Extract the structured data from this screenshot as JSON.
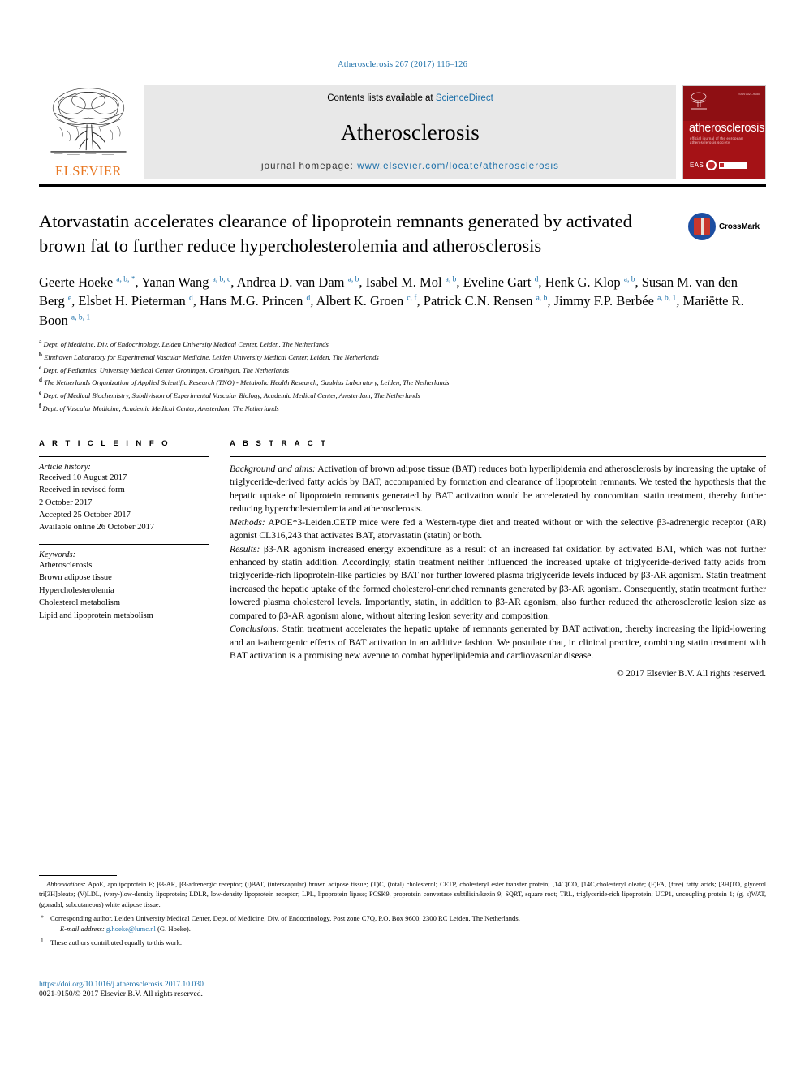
{
  "running_head": "Atherosclerosis 267 (2017) 116–126",
  "accent_color": "#1a6ea8",
  "banner": {
    "publisher_name": "ELSEVIER",
    "publisher_logo_icon": "elsevier-tree-icon",
    "contents_prefix": "Contents lists available at ",
    "contents_link": "ScienceDirect",
    "journal_title": "Atherosclerosis",
    "homepage_label": "journal homepage: ",
    "homepage_url": "www.elsevier.com/locate/atherosclerosis",
    "cover": {
      "journal_name": "atherosclerosis",
      "subtitle": "official journal of the european atherosclerosis society",
      "issn_text": "ISSN 0021-9150",
      "society_label": "EAS",
      "brand_color": "#a51216"
    }
  },
  "article": {
    "title": "Atorvastatin accelerates clearance of lipoprotein remnants generated by activated brown fat to further reduce hypercholesterolemia and atherosclerosis",
    "crossmark_label": "CrossMark",
    "authors_html": "Geerte Hoeke <sup>a, b, *</sup>, Yanan Wang <sup>a, b, c</sup>, Andrea D. van Dam <sup>a, b</sup>, Isabel M. Mol <sup>a, b</sup>, Eveline Gart <sup>d</sup>, Henk G. Klop <sup>a, b</sup>, Susan M. van den Berg <sup>e</sup>, Elsbet H. Pieterman <sup>d</sup>, Hans M.G. Princen <sup>d</sup>, Albert K. Groen <sup>c, f</sup>, Patrick C.N. Rensen <sup>a, b</sup>, Jimmy F.P. Berbée <sup>a, b, 1</sup>, Mariëtte R. Boon <sup>a, b, 1</sup>",
    "affiliations": [
      {
        "mark": "a",
        "text": "Dept. of Medicine, Div. of Endocrinology, Leiden University Medical Center, Leiden, The Netherlands"
      },
      {
        "mark": "b",
        "text": "Einthoven Laboratory for Experimental Vascular Medicine, Leiden University Medical Center, Leiden, The Netherlands"
      },
      {
        "mark": "c",
        "text": "Dept. of Pediatrics, University Medical Center Groningen, Groningen, The Netherlands"
      },
      {
        "mark": "d",
        "text": "The Netherlands Organization of Applied Scientific Research (TNO) - Metabolic Health Research, Gaubius Laboratory, Leiden, The Netherlands"
      },
      {
        "mark": "e",
        "text": "Dept. of Medical Biochemistry, Subdivision of Experimental Vascular Biology, Academic Medical Center, Amsterdam, The Netherlands"
      },
      {
        "mark": "f",
        "text": "Dept. of Vascular Medicine, Academic Medical Center, Amsterdam, The Netherlands"
      }
    ]
  },
  "article_info": {
    "heading": "A R T I C L E   I N F O",
    "history_label": "Article history:",
    "history_lines": [
      "Received 10 August 2017",
      "Received in revised form",
      "2 October 2017",
      "Accepted 25 October 2017",
      "Available online 26 October 2017"
    ],
    "keywords_label": "Keywords:",
    "keywords": [
      "Atherosclerosis",
      "Brown adipose tissue",
      "Hypercholesterolemia",
      "Cholesterol metabolism",
      "Lipid and lipoprotein metabolism"
    ]
  },
  "abstract": {
    "heading": "A B S T R A C T",
    "paragraphs": [
      {
        "lead": "Background and aims:",
        "text": " Activation of brown adipose tissue (BAT) reduces both hyperlipidemia and atherosclerosis by increasing the uptake of triglyceride-derived fatty acids by BAT, accompanied by formation and clearance of lipoprotein remnants. We tested the hypothesis that the hepatic uptake of lipoprotein remnants generated by BAT activation would be accelerated by concomitant statin treatment, thereby further reducing hypercholesterolemia and atherosclerosis."
      },
      {
        "lead": "Methods:",
        "text": " APOE*3-Leiden.CETP mice were fed a Western-type diet and treated without or with the selective β3-adrenergic receptor (AR) agonist CL316,243 that activates BAT, atorvastatin (statin) or both."
      },
      {
        "lead": "Results:",
        "text": " β3-AR agonism increased energy expenditure as a result of an increased fat oxidation by activated BAT, which was not further enhanced by statin addition. Accordingly, statin treatment neither influenced the increased uptake of triglyceride-derived fatty acids from triglyceride-rich lipoprotein-like particles by BAT nor further lowered plasma triglyceride levels induced by β3-AR agonism. Statin treatment increased the hepatic uptake of the formed cholesterol-enriched remnants generated by β3-AR agonism. Consequently, statin treatment further lowered plasma cholesterol levels. Importantly, statin, in addition to β3-AR agonism, also further reduced the atherosclerotic lesion size as compared to β3-AR agonism alone, without altering lesion severity and composition."
      },
      {
        "lead": "Conclusions:",
        "text": " Statin treatment accelerates the hepatic uptake of remnants generated by BAT activation, thereby increasing the lipid-lowering and anti-atherogenic effects of BAT activation in an additive fashion. We postulate that, in clinical practice, combining statin treatment with BAT activation is a promising new avenue to combat hyperlipidemia and cardiovascular disease."
      }
    ],
    "copyright": "© 2017 Elsevier B.V. All rights reserved."
  },
  "footnotes": {
    "abbreviations_label": "Abbreviations:",
    "abbreviations_text": " ApoE, apolipoprotein E; β3-AR, β3-adrenergic receptor; (i)BAT, (interscapular) brown adipose tissue; (T)C, (total) cholesterol; CETP, cholesteryl ester transfer protein; [14C]CO, [14C]cholesteryl oleate; (F)FA, (free) fatty acids; [3H]TO, glycerol tri[3H]oleate; (V)LDL, (very-)low-density lipoprotein; LDLR, low-density lipoprotein receptor; LPL, lipoprotein lipase; PCSK9, proprotein convertase subtilisin/kexin 9; SQRT, square root; TRL, triglyceride-rich lipoprotein; UCP1, uncoupling protein 1; (g, s)WAT, (gonadal, subcutaneous) white adipose tissue.",
    "corresponding_mark": "*",
    "corresponding_text": "Corresponding author. Leiden University Medical Center, Dept. of Medicine, Div. of Endocrinology, Post zone C7Q, P.O. Box 9600, 2300 RC Leiden, The Netherlands.",
    "email_label": "E-mail address:",
    "email_address": "g.hoeke@lumc.nl",
    "email_owner": " (G. Hoeke).",
    "equal_mark": "1",
    "equal_text": "These authors contributed equally to this work.",
    "doi": "https://doi.org/10.1016/j.atherosclerosis.2017.10.030",
    "issn_line": "0021-9150/© 2017 Elsevier B.V. All rights reserved."
  }
}
